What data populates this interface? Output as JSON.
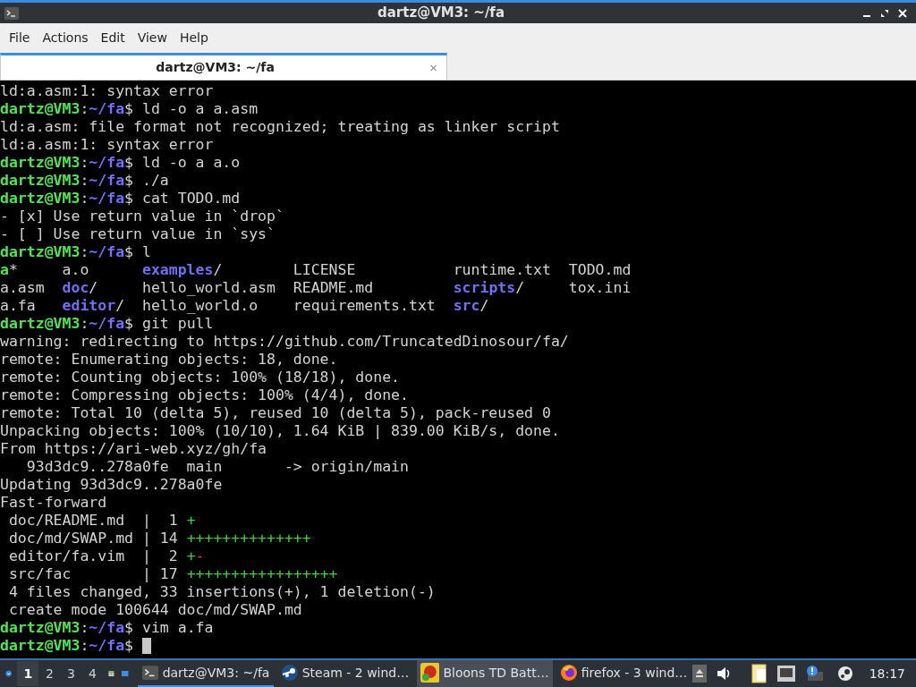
{
  "window": {
    "title": "dartz@VM3: ~/fa"
  },
  "menu": [
    "File",
    "Actions",
    "Edit",
    "View",
    "Help"
  ],
  "tabs": [
    {
      "label": "dartz@VM3: ~/fa",
      "selected": true,
      "close": "×"
    }
  ],
  "terminal": {
    "cursor_visible": true,
    "lines": [
      [
        {
          "kind": "plain",
          "text": "ld:a.asm:1: syntax error"
        }
      ],
      [
        {
          "kind": "user",
          "text": "dartz@VM3"
        },
        {
          "kind": "plain",
          "text": ":"
        },
        {
          "kind": "path",
          "text": "~/fa"
        },
        {
          "kind": "plain",
          "text": "$ ld -o a a.asm"
        }
      ],
      [
        {
          "kind": "plain",
          "text": "ld:a.asm: file format not recognized; treating as linker script"
        }
      ],
      [
        {
          "kind": "plain",
          "text": "ld:a.asm:1: syntax error"
        }
      ],
      [
        {
          "kind": "user",
          "text": "dartz@VM3"
        },
        {
          "kind": "plain",
          "text": ":"
        },
        {
          "kind": "path",
          "text": "~/fa"
        },
        {
          "kind": "plain",
          "text": "$ ld -o a a.o"
        }
      ],
      [
        {
          "kind": "user",
          "text": "dartz@VM3"
        },
        {
          "kind": "plain",
          "text": ":"
        },
        {
          "kind": "path",
          "text": "~/fa"
        },
        {
          "kind": "plain",
          "text": "$ ./a"
        }
      ],
      [
        {
          "kind": "user",
          "text": "dartz@VM3"
        },
        {
          "kind": "plain",
          "text": ":"
        },
        {
          "kind": "path",
          "text": "~/fa"
        },
        {
          "kind": "plain",
          "text": "$ cat TODO.md"
        }
      ],
      [
        {
          "kind": "plain",
          "text": "- [x] Use return value in `drop`"
        }
      ],
      [
        {
          "kind": "plain",
          "text": "- [ ] Use return value in `sys`"
        }
      ],
      [
        {
          "kind": "user",
          "text": "dartz@VM3"
        },
        {
          "kind": "plain",
          "text": ":"
        },
        {
          "kind": "path",
          "text": "~/fa"
        },
        {
          "kind": "plain",
          "text": "$ l"
        }
      ],
      [
        {
          "kind": "exec",
          "text": "a"
        },
        {
          "kind": "plain",
          "text": "*     a.o      "
        },
        {
          "kind": "dir",
          "text": "examples"
        },
        {
          "kind": "plain",
          "text": "/        LICENSE           runtime.txt  TODO.md"
        }
      ],
      [
        {
          "kind": "plain",
          "text": "a.asm  "
        },
        {
          "kind": "dir",
          "text": "doc"
        },
        {
          "kind": "plain",
          "text": "/     hello_world.asm  README.md         "
        },
        {
          "kind": "dir",
          "text": "scripts"
        },
        {
          "kind": "plain",
          "text": "/     tox.ini"
        }
      ],
      [
        {
          "kind": "plain",
          "text": "a.fa   "
        },
        {
          "kind": "dir",
          "text": "editor"
        },
        {
          "kind": "plain",
          "text": "/  hello_world.o    requirements.txt  "
        },
        {
          "kind": "dir",
          "text": "src"
        },
        {
          "kind": "plain",
          "text": "/"
        }
      ],
      [
        {
          "kind": "user",
          "text": "dartz@VM3"
        },
        {
          "kind": "plain",
          "text": ":"
        },
        {
          "kind": "path",
          "text": "~/fa"
        },
        {
          "kind": "plain",
          "text": "$ git pull"
        }
      ],
      [
        {
          "kind": "plain",
          "text": "warning: redirecting to https://github.com/TruncatedDinosour/fa/"
        }
      ],
      [
        {
          "kind": "plain",
          "text": "remote: Enumerating objects: 18, done."
        }
      ],
      [
        {
          "kind": "plain",
          "text": "remote: Counting objects: 100% (18/18), done."
        }
      ],
      [
        {
          "kind": "plain",
          "text": "remote: Compressing objects: 100% (4/4), done."
        }
      ],
      [
        {
          "kind": "plain",
          "text": "remote: Total 10 (delta 5), reused 10 (delta 5), pack-reused 0"
        }
      ],
      [
        {
          "kind": "plain",
          "text": "Unpacking objects: 100% (10/10), 1.64 KiB | 839.00 KiB/s, done."
        }
      ],
      [
        {
          "kind": "plain",
          "text": "From https://ari-web.xyz/gh/fa"
        }
      ],
      [
        {
          "kind": "plain",
          "text": "   93d3dc9..278a0fe  main       -> origin/main"
        }
      ],
      [
        {
          "kind": "plain",
          "text": "Updating 93d3dc9..278a0fe"
        }
      ],
      [
        {
          "kind": "plain",
          "text": "Fast-forward"
        }
      ],
      [
        {
          "kind": "plain",
          "text": " doc/README.md  |  1 "
        },
        {
          "kind": "add",
          "text": "+"
        }
      ],
      [
        {
          "kind": "plain",
          "text": " doc/md/SWAP.md | 14 "
        },
        {
          "kind": "add",
          "text": "++++++++++++++"
        }
      ],
      [
        {
          "kind": "plain",
          "text": " editor/fa.vim  |  2 "
        },
        {
          "kind": "add",
          "text": "+"
        },
        {
          "kind": "del",
          "text": "-"
        }
      ],
      [
        {
          "kind": "plain",
          "text": " src/fac        | 17 "
        },
        {
          "kind": "add",
          "text": "+++++++++++++++++"
        }
      ],
      [
        {
          "kind": "plain",
          "text": " 4 files changed, 33 insertions(+), 1 deletion(-)"
        }
      ],
      [
        {
          "kind": "plain",
          "text": " create mode 100644 doc/md/SWAP.md"
        }
      ],
      [
        {
          "kind": "user",
          "text": "dartz@VM3"
        },
        {
          "kind": "plain",
          "text": ":"
        },
        {
          "kind": "path",
          "text": "~/fa"
        },
        {
          "kind": "plain",
          "text": "$ vim a.fa"
        }
      ],
      [
        {
          "kind": "user",
          "text": "dartz@VM3"
        },
        {
          "kind": "plain",
          "text": ":"
        },
        {
          "kind": "path",
          "text": "~/fa"
        },
        {
          "kind": "plain",
          "text": "$"
        }
      ]
    ]
  },
  "taskbar": {
    "workspaces": [
      {
        "label": "1",
        "selected": true
      },
      {
        "label": "2",
        "selected": false
      },
      {
        "label": "3",
        "selected": false
      },
      {
        "label": "4",
        "selected": false
      }
    ],
    "tasks": [
      {
        "kind": "terminal",
        "label": "dartz@VM3: ~/fa",
        "selected": true,
        "highlighted": false
      },
      {
        "kind": "steam",
        "label": "Steam - 2 wind…",
        "selected": false,
        "highlighted": false
      },
      {
        "kind": "game",
        "label": "Bloons TD Batt…",
        "selected": false,
        "highlighted": true
      },
      {
        "kind": "firefox",
        "label": "firefox - 3 wind…",
        "selected": false,
        "highlighted": false
      }
    ],
    "clock": "18:17"
  }
}
